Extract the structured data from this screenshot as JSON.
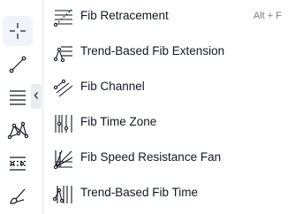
{
  "toolbar": {
    "tools": [
      {
        "icon": "crosshair-icon",
        "active": true
      },
      {
        "icon": "trend-line-icon"
      },
      {
        "icon": "fib-retracement-icon"
      },
      {
        "icon": "pattern-icon"
      },
      {
        "icon": "prediction-measure-icon"
      },
      {
        "icon": "brush-icon"
      }
    ],
    "flyout_toggle_icon": "chevron-left-icon"
  },
  "menu": {
    "items": [
      {
        "label": "Fib Retracement",
        "shortcut": "Alt + F",
        "icon": "fib-retracement-icon"
      },
      {
        "label": "Trend-Based Fib Extension",
        "icon": "trend-based-fib-extension-icon"
      },
      {
        "label": "Fib Channel",
        "icon": "fib-channel-icon"
      },
      {
        "label": "Fib Time Zone",
        "icon": "fib-time-zone-icon"
      },
      {
        "label": "Fib Speed Resistance Fan",
        "icon": "fib-speed-resistance-fan-icon"
      },
      {
        "label": "Trend-Based Fib Time",
        "icon": "trend-based-fib-time-icon"
      }
    ]
  },
  "colors": {
    "icon": "#131722",
    "text": "#131722",
    "shortcut": "#787b86",
    "active_bg": "#f0f3fa",
    "divider": "#e0e3eb"
  }
}
